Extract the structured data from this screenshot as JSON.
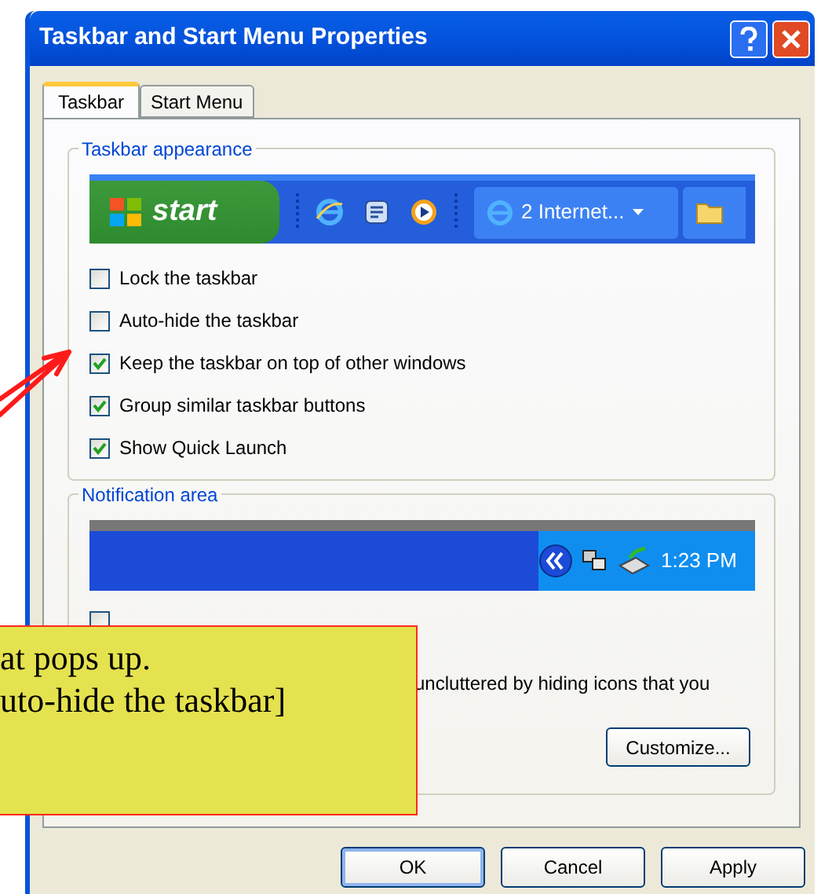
{
  "window": {
    "title": "Taskbar and Start Menu Properties"
  },
  "tabs": [
    {
      "label": "Taskbar",
      "selected": true
    },
    {
      "label": "Start Menu",
      "selected": false
    }
  ],
  "taskbar_appearance": {
    "title": "Taskbar appearance",
    "preview": {
      "start_label": "start",
      "task_button": "2 Internet..."
    },
    "options": [
      {
        "label": "Lock the taskbar",
        "checked": false
      },
      {
        "label": "Auto-hide the taskbar",
        "checked": false
      },
      {
        "label": "Keep the taskbar on top of other windows",
        "checked": true
      },
      {
        "label": "Group similar taskbar buttons",
        "checked": true
      },
      {
        "label": "Show Quick Launch",
        "checked": true
      }
    ]
  },
  "notification_area": {
    "title": "Notification area",
    "preview": {
      "time": "1:23 PM"
    },
    "options": [
      {
        "checked": false
      }
    ],
    "description": "uncluttered by hiding icons that you",
    "button": "Customize..."
  },
  "buttons": [
    "OK",
    "Cancel",
    "Apply"
  ],
  "callout": {
    "lines": [
      "at pops up.",
      "uto-hide the taskbar]"
    ]
  }
}
